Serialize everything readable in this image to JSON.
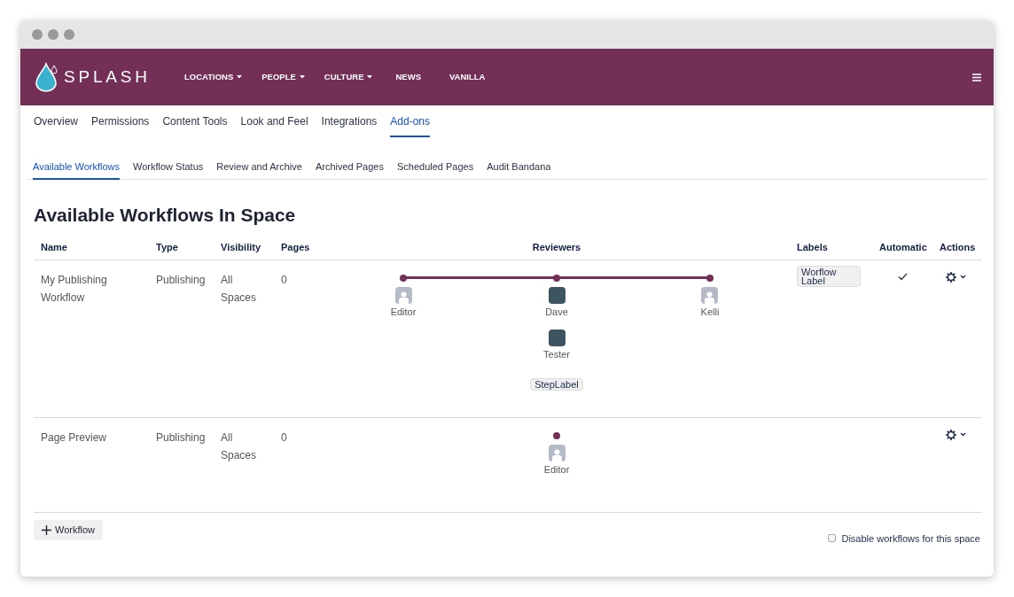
{
  "brand": {
    "name": "SPLASH"
  },
  "nav": [
    {
      "label": "LOCATIONS",
      "dropdown": true
    },
    {
      "label": "PEOPLE",
      "dropdown": true
    },
    {
      "label": "CULTURE",
      "dropdown": true
    },
    {
      "label": "NEWS",
      "dropdown": false
    },
    {
      "label": "VANILLA",
      "dropdown": false
    }
  ],
  "tabs": [
    {
      "label": "Overview",
      "selected": false
    },
    {
      "label": "Permissions",
      "selected": false
    },
    {
      "label": "Content Tools",
      "selected": false
    },
    {
      "label": "Look and Feel",
      "selected": false
    },
    {
      "label": "Integrations",
      "selected": false
    },
    {
      "label": "Add-ons",
      "selected": true
    }
  ],
  "subtabs": [
    {
      "label": "Available Workflows",
      "selected": true
    },
    {
      "label": "Workflow Status",
      "selected": false
    },
    {
      "label": "Review and Archive",
      "selected": false
    },
    {
      "label": "Archived Pages",
      "selected": false
    },
    {
      "label": "Scheduled Pages",
      "selected": false
    },
    {
      "label": "Audit Bandana",
      "selected": false
    }
  ],
  "heading": "Available Workflows In Space",
  "table": {
    "columns": [
      "Name",
      "Type",
      "Visibility",
      "Pages",
      "Reviewers",
      "Labels",
      "Automatic",
      "Actions"
    ],
    "rows": [
      {
        "name": "My Publishing Workflow",
        "type": "Publishing",
        "visibility": "All Spaces",
        "pages": "0",
        "steps": [
          {
            "reviewers": [
              {
                "name": "Editor",
                "kind": "placeholder"
              }
            ]
          },
          {
            "reviewers": [
              {
                "name": "Dave",
                "kind": "photo"
              },
              {
                "name": "Tester",
                "kind": "photo"
              }
            ],
            "label": "StepLabel"
          },
          {
            "reviewers": [
              {
                "name": "Kelli",
                "kind": "placeholder"
              }
            ]
          }
        ],
        "labels": [
          "Worflow Label"
        ],
        "automatic": true
      },
      {
        "name": "Page Preview",
        "type": "Publishing",
        "visibility": "All Spaces",
        "pages": "0",
        "steps": [
          {
            "reviewers": [
              {
                "name": "Editor",
                "kind": "placeholder"
              }
            ]
          }
        ],
        "labels": [],
        "automatic": false
      }
    ]
  },
  "add_button": "Workflow",
  "disable_option": {
    "label": "Disable workflows for this space",
    "checked": false
  }
}
